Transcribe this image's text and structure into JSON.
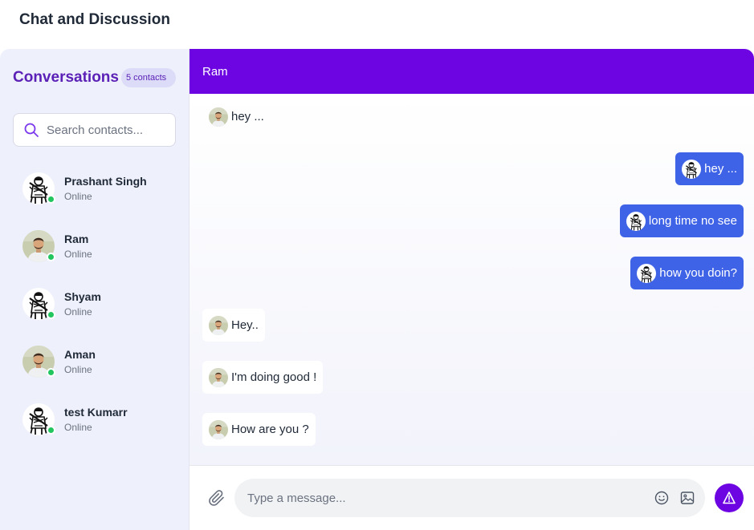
{
  "page": {
    "title": "Chat and Discussion"
  },
  "sidebar": {
    "title": "Conversations",
    "count_label": "5 contacts",
    "search_placeholder": "Search contacts...",
    "contacts": [
      {
        "name": "Prashant Singh",
        "status": "Online",
        "avatar": "sketch"
      },
      {
        "name": "Ram",
        "status": "Online",
        "avatar": "photo"
      },
      {
        "name": "Shyam",
        "status": "Online",
        "avatar": "sketch"
      },
      {
        "name": "Aman",
        "status": "Online",
        "avatar": "photo"
      },
      {
        "name": "test Kumarr",
        "status": "Online",
        "avatar": "sketch"
      }
    ]
  },
  "chat": {
    "contact_name": "Ram",
    "messages": [
      {
        "direction": "in",
        "text": "hey ..."
      },
      {
        "direction": "out",
        "text": "hey ..."
      },
      {
        "direction": "out",
        "text": "long time no see"
      },
      {
        "direction": "out",
        "text": "how you doin?"
      },
      {
        "direction": "in",
        "text": "Hey.."
      },
      {
        "direction": "in",
        "text": "I'm doing good !"
      },
      {
        "direction": "in",
        "text": "How are you ?"
      }
    ],
    "composer": {
      "placeholder": "Type a message...",
      "icons": [
        "paperclip-icon",
        "emoji-icon",
        "image-icon",
        "send-icon"
      ]
    }
  },
  "colors": {
    "accent": "#6d05e3",
    "outgoing_bubble": "#3f63e6",
    "sidebar_bg": "#eef0fc",
    "online": "#22c55e"
  }
}
